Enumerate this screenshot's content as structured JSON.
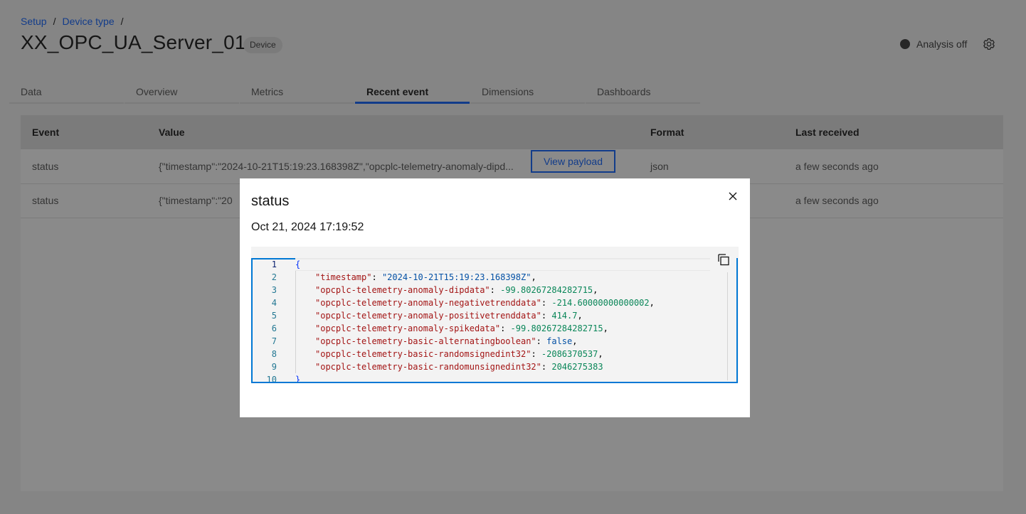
{
  "breadcrumb": [
    {
      "label": "Setup"
    },
    {
      "label": "Device type"
    }
  ],
  "breadcrumb_separator": "/",
  "page": {
    "title": "XX_OPC_UA_Server_01",
    "tag": "Device",
    "analysis_status": "Analysis off"
  },
  "icons": {
    "status_dot": "status-dot-icon",
    "settings": "gear-icon",
    "close": "close-icon",
    "copy": "copy-icon"
  },
  "tabs": [
    {
      "label": "Data",
      "active": false
    },
    {
      "label": "Overview",
      "active": false
    },
    {
      "label": "Metrics",
      "active": false
    },
    {
      "label": "Recent event",
      "active": true
    },
    {
      "label": "Dimensions",
      "active": false
    },
    {
      "label": "Dashboards",
      "active": false
    }
  ],
  "table": {
    "headers": [
      "Event",
      "Value",
      "Format",
      "Last received"
    ],
    "rows": [
      {
        "event": "status",
        "value": "{\"timestamp\":\"2024-10-21T15:19:23.168398Z\",\"opcplc-telemetry-anomaly-dipd...",
        "action": "View payload",
        "format": "json",
        "last_received": "a few seconds ago"
      },
      {
        "event": "status",
        "value": "{\"timestamp\":\"20",
        "action": "",
        "format": "",
        "last_received": "a few seconds ago"
      }
    ]
  },
  "modal": {
    "title": "status",
    "date": "Oct 21, 2024 17:19:52",
    "close_label": "×",
    "code_lines": [
      {
        "n": "1",
        "parts": [
          {
            "t": "brace",
            "v": "{"
          }
        ]
      },
      {
        "n": "2",
        "indent": true,
        "parts": [
          {
            "t": "key",
            "v": "\"timestamp\""
          },
          {
            "t": "punct",
            "v": ": "
          },
          {
            "t": "str",
            "v": "\"2024-10-21T15:19:23.168398Z\""
          },
          {
            "t": "punct",
            "v": ","
          }
        ]
      },
      {
        "n": "3",
        "indent": true,
        "parts": [
          {
            "t": "key",
            "v": "\"opcplc-telemetry-anomaly-dipdata\""
          },
          {
            "t": "punct",
            "v": ": "
          },
          {
            "t": "num",
            "v": "-99.80267284282715"
          },
          {
            "t": "punct",
            "v": ","
          }
        ]
      },
      {
        "n": "4",
        "indent": true,
        "parts": [
          {
            "t": "key",
            "v": "\"opcplc-telemetry-anomaly-negativetrenddata\""
          },
          {
            "t": "punct",
            "v": ": "
          },
          {
            "t": "num",
            "v": "-214.60000000000002"
          },
          {
            "t": "punct",
            "v": ","
          }
        ]
      },
      {
        "n": "5",
        "indent": true,
        "parts": [
          {
            "t": "key",
            "v": "\"opcplc-telemetry-anomaly-positivetrenddata\""
          },
          {
            "t": "punct",
            "v": ": "
          },
          {
            "t": "num",
            "v": "414.7"
          },
          {
            "t": "punct",
            "v": ","
          }
        ]
      },
      {
        "n": "6",
        "indent": true,
        "parts": [
          {
            "t": "key",
            "v": "\"opcplc-telemetry-anomaly-spikedata\""
          },
          {
            "t": "punct",
            "v": ": "
          },
          {
            "t": "num",
            "v": "-99.80267284282715"
          },
          {
            "t": "punct",
            "v": ","
          }
        ]
      },
      {
        "n": "7",
        "indent": true,
        "parts": [
          {
            "t": "key",
            "v": "\"opcplc-telemetry-basic-alternatingboolean\""
          },
          {
            "t": "punct",
            "v": ": "
          },
          {
            "t": "kw",
            "v": "false"
          },
          {
            "t": "punct",
            "v": ","
          }
        ]
      },
      {
        "n": "8",
        "indent": true,
        "parts": [
          {
            "t": "key",
            "v": "\"opcplc-telemetry-basic-randomsignedint32\""
          },
          {
            "t": "punct",
            "v": ": "
          },
          {
            "t": "num",
            "v": "-2086370537"
          },
          {
            "t": "punct",
            "v": ","
          }
        ]
      },
      {
        "n": "9",
        "indent": true,
        "parts": [
          {
            "t": "key",
            "v": "\"opcplc-telemetry-basic-randomunsignedint32\""
          },
          {
            "t": "punct",
            "v": ": "
          },
          {
            "t": "num",
            "v": "2046275383"
          }
        ]
      },
      {
        "n": "10",
        "parts": [
          {
            "t": "brace",
            "v": "}"
          }
        ]
      }
    ]
  },
  "colors": {
    "accent": "#0f62fe",
    "editor_focus": "#0078d4",
    "json_key": "#a31515",
    "json_string": "#0451a5",
    "json_number": "#098658"
  }
}
